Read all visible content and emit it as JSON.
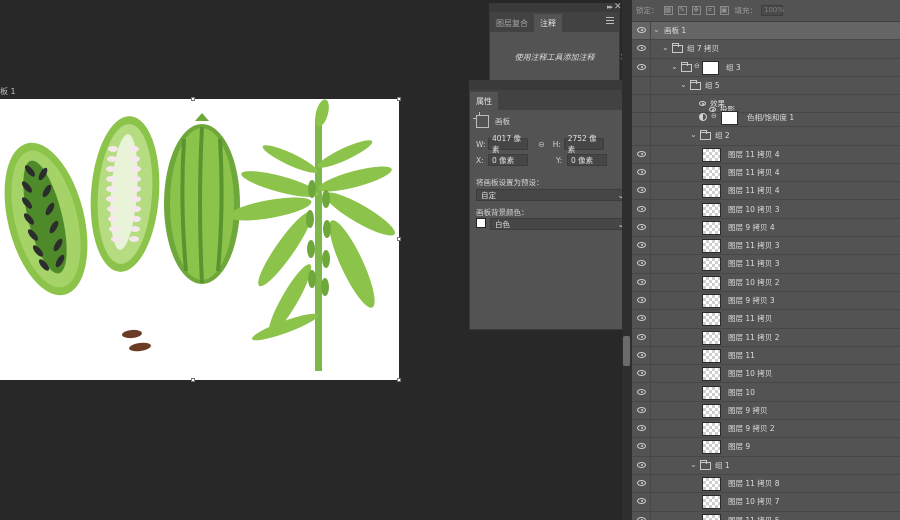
{
  "canvas": {
    "artboard_label": "板 1"
  },
  "comments_panel": {
    "tab_comp": "图层复合",
    "tab_notes": "注释",
    "hint": "使用注释工具添加注释"
  },
  "properties_panel": {
    "tab": "属性",
    "type_label": "画板",
    "w_label": "W:",
    "w_value": "4017 像素",
    "h_label": "H:",
    "h_value": "2752 像素",
    "x_label": "X:",
    "x_value": "0 像素",
    "y_label": "Y:",
    "y_value": "0 像素",
    "preset_label": "将画板设置为预设：",
    "preset_value": "自定",
    "bg_label": "画板背景颜色：",
    "bg_value": "白色"
  },
  "layers_panel": {
    "lock_label": "锁定：",
    "fill_label": "填充：",
    "fill_value": "100%",
    "rows": [
      {
        "name": "画板 1"
      },
      {
        "name": "组 7 拷贝"
      },
      {
        "name": "组 3"
      },
      {
        "name": "组 5"
      },
      {
        "name": "效果"
      },
      {
        "name": "投影"
      },
      {
        "name": "色相/饱和度 1"
      },
      {
        "name": "组 2"
      },
      {
        "name": "图层 11 拷贝 4"
      },
      {
        "name": "图层 11 拷贝 4"
      },
      {
        "name": "图层 11 拷贝 4"
      },
      {
        "name": "图层 10 拷贝 3"
      },
      {
        "name": "图层 9 拷贝 4"
      },
      {
        "name": "图层 11 拷贝 3"
      },
      {
        "name": "图层 11 拷贝 3"
      },
      {
        "name": "图层 10 拷贝 2"
      },
      {
        "name": "图层 9 拷贝 3"
      },
      {
        "name": "图层 11 拷贝"
      },
      {
        "name": "图层 11 拷贝 2"
      },
      {
        "name": "图层 11"
      },
      {
        "name": "图层 10 拷贝"
      },
      {
        "name": "图层 10"
      },
      {
        "name": "图层 9 拷贝"
      },
      {
        "name": "图层 9 拷贝 2"
      },
      {
        "name": "图层 9"
      },
      {
        "name": "组 1"
      },
      {
        "name": "图层 11 拷贝 8"
      },
      {
        "name": "图层 10 拷贝 7"
      },
      {
        "name": "图层 11 拷贝 5"
      }
    ]
  }
}
